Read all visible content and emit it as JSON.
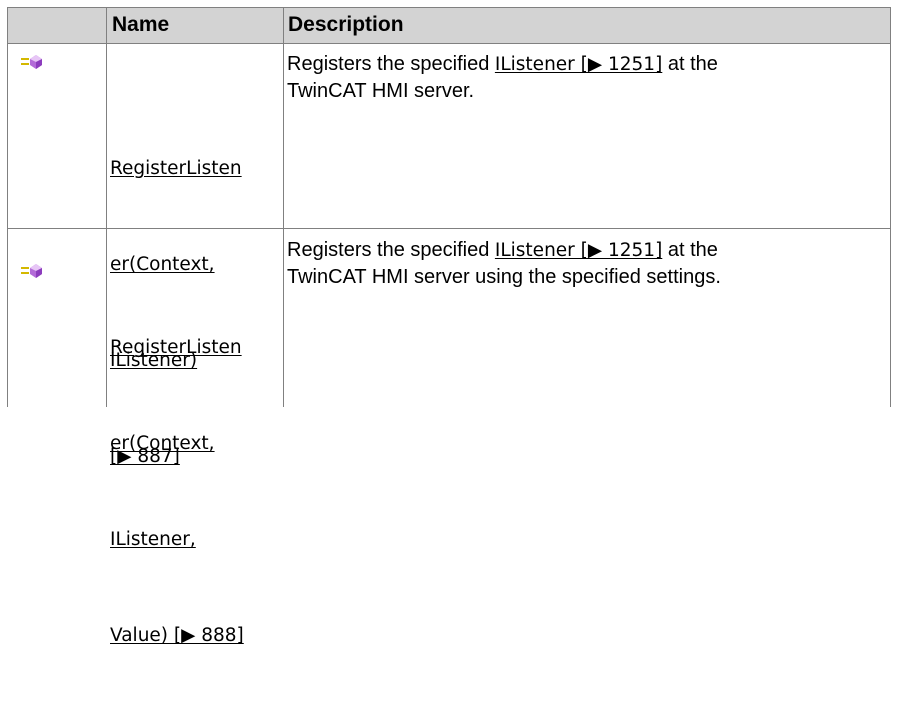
{
  "header": {
    "name": "Name",
    "description": "Description"
  },
  "rows": [
    {
      "icon": "public-method-icon",
      "name_lines": [
        "RegisterListen",
        "er(Context,",
        "IListener)",
        "[▶ 887]"
      ],
      "description": {
        "before": "Registers the specified ",
        "link": "IListener [▶ 1251]",
        "after_line1": " at the",
        "line2": "TwinCAT HMI server."
      }
    },
    {
      "icon": "public-method-icon",
      "name_lines": [
        "RegisterListen",
        "er(Context,",
        "IListener,",
        "Value) [▶ 888]"
      ],
      "description": {
        "before": "Registers the specified ",
        "link": "IListener [▶ 1251]",
        "after_line1": " at the",
        "line2": "TwinCAT HMI server using the specified settings."
      }
    }
  ]
}
